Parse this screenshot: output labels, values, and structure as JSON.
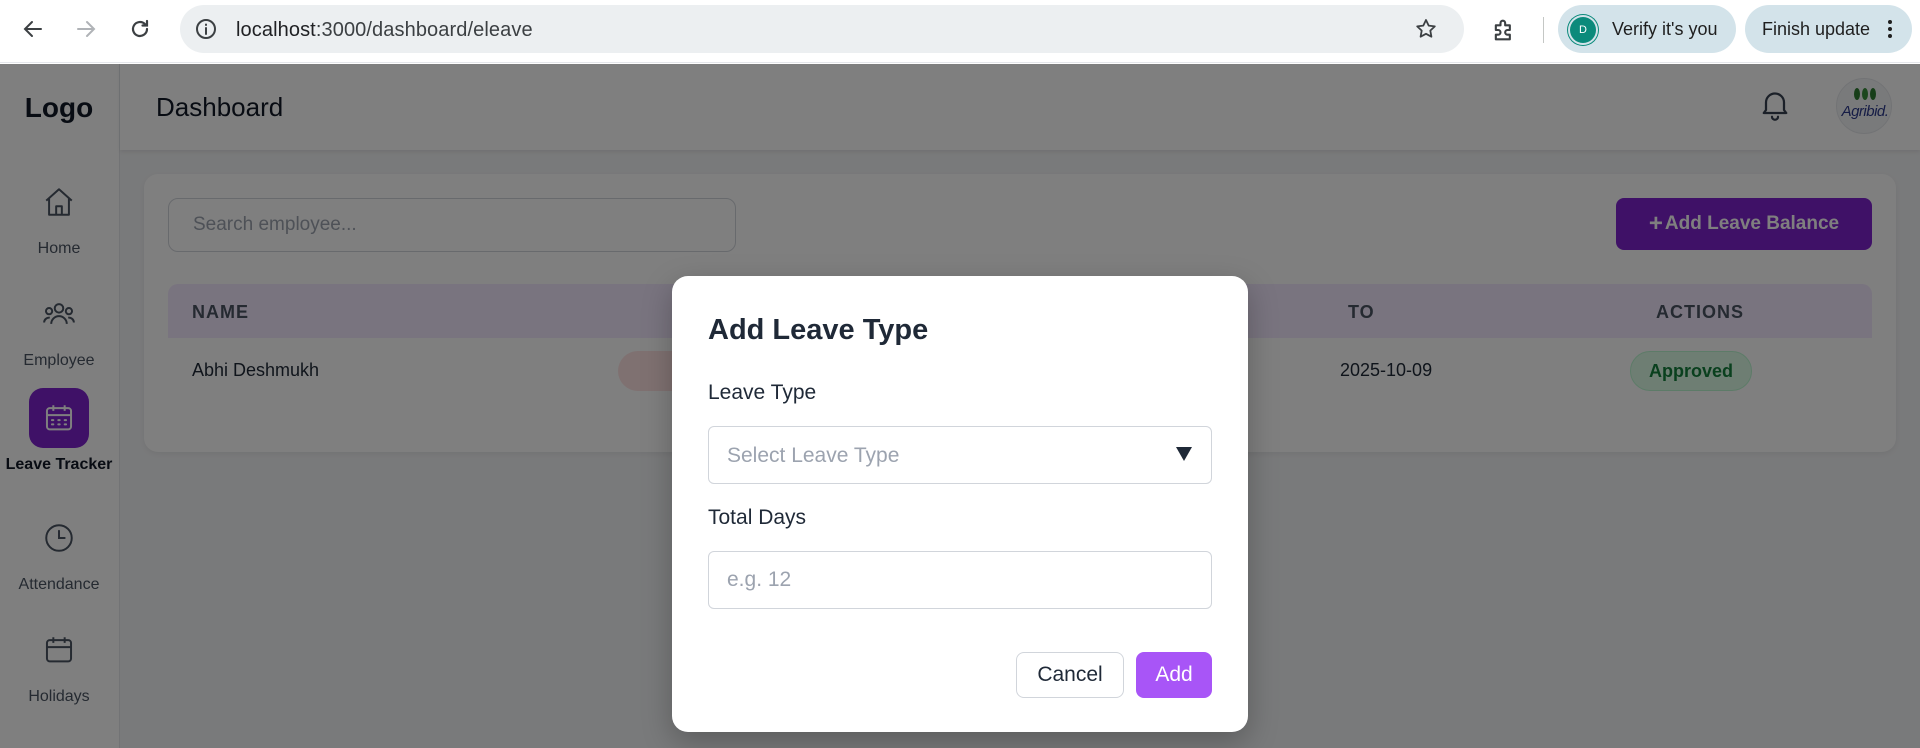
{
  "browser": {
    "url_host": "localhost",
    "url_rest": ":3000/dashboard/eleave",
    "verify_label": "Verify it's you",
    "profile_initial": "D",
    "update_label": "Finish update"
  },
  "sidebar": {
    "logo": "Logo",
    "items": [
      {
        "label": "Home",
        "icon": "home-icon",
        "active": false
      },
      {
        "label": "Employee",
        "icon": "users-icon",
        "active": false
      },
      {
        "label": "Leave Tracker",
        "icon": "calendar-icon",
        "active": true
      },
      {
        "label": "Attendance",
        "icon": "clock-icon",
        "active": false
      },
      {
        "label": "Holidays",
        "icon": "calendar-outline-icon",
        "active": false
      }
    ]
  },
  "header": {
    "title": "Dashboard",
    "avatar_brand": "Agribid."
  },
  "main": {
    "search_placeholder": "Search employee...",
    "add_balance_label": "Add Leave Balance",
    "columns": {
      "name": "NAME",
      "to": "TO",
      "actions": "ACTIONS"
    },
    "rows": [
      {
        "name": "Abhi Deshmukh",
        "to": "2025-10-09",
        "status": "Approved"
      }
    ]
  },
  "modal": {
    "title": "Add Leave Type",
    "leave_type_label": "Leave Type",
    "leave_type_value": "Select Leave Type",
    "total_days_label": "Total Days",
    "total_days_placeholder": "e.g. 12",
    "cancel_label": "Cancel",
    "add_label": "Add"
  },
  "colors": {
    "accent": "#7e22ce",
    "modal_add": "#a855f7",
    "approved_bg": "#dcfce7",
    "approved_text": "#15803d",
    "table_header_bg": "#f3e8ff"
  }
}
